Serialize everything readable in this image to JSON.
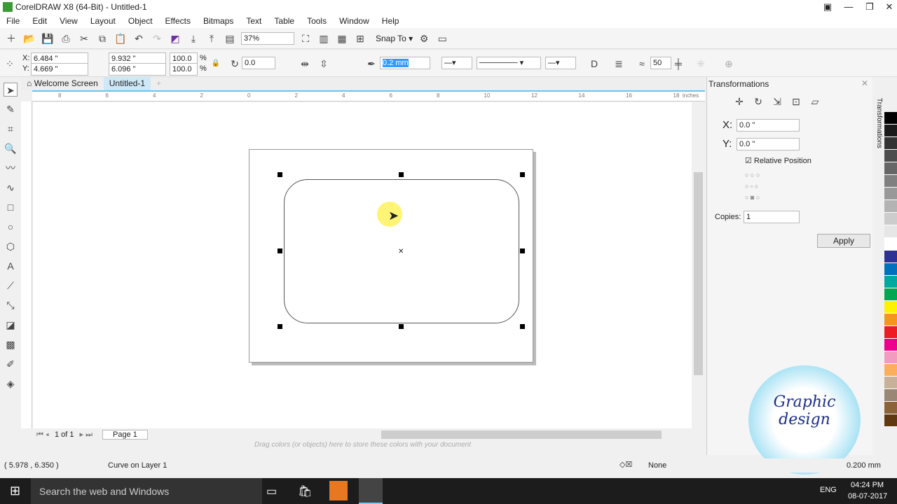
{
  "window": {
    "title": "CorelDRAW X8 (64-Bit) - Untitled-1"
  },
  "menu": [
    "File",
    "Edit",
    "View",
    "Layout",
    "Object",
    "Effects",
    "Bitmaps",
    "Text",
    "Table",
    "Tools",
    "Window",
    "Help"
  ],
  "toolbar": {
    "zoom": "37%",
    "snap_to": "Snap To"
  },
  "propbar": {
    "x": "6.484 \"",
    "y": "4.669 \"",
    "w": "9.932 \"",
    "h": "6.096 \"",
    "sx": "100.0",
    "sy": "100.0",
    "pct": "%",
    "rotation": "0.0",
    "outline": "0.2 mm",
    "smooth": "50"
  },
  "tabs": {
    "welcome": "Welcome Screen",
    "doc": "Untitled-1"
  },
  "ruler": {
    "labels": [
      "8",
      "6",
      "4",
      "2",
      "0",
      "2",
      "4",
      "6",
      "8",
      "10",
      "12",
      "14",
      "16",
      "18"
    ],
    "unit": "inches"
  },
  "docker": {
    "title": "Transformations",
    "side_label": "Transformations",
    "x_label": "X:",
    "x": "0.0 \"",
    "y_label": "Y:",
    "y": "0.0 \"",
    "relative": "Relative Position",
    "relative_checked": true,
    "copies_label": "Copies:",
    "copies": "1",
    "apply": "Apply"
  },
  "pagenav": {
    "pos": "1",
    "of": "of",
    "total": "1",
    "page_tab": "Page 1"
  },
  "palette_hint": "Drag colors (or objects) here to store these colors with your document",
  "palette_colors": [
    "#000000",
    "#1a1a1a",
    "#333333",
    "#4d4d4d",
    "#666666",
    "#808080",
    "#999999",
    "#b3b3b3",
    "#cccccc",
    "#e6e6e6",
    "#ffffff",
    "#2e3192",
    "#0072bc",
    "#00a99d",
    "#00a651",
    "#fff200",
    "#f7941d",
    "#ed1c24",
    "#ec008c",
    "#f49ac1",
    "#fbaf5d",
    "#c7b299",
    "#998675",
    "#8c6239",
    "#603913"
  ],
  "status": {
    "coords": "( 5.978 , 6.350 )",
    "object": "Curve on Layer 1",
    "fill": "None",
    "outline": "0.200 mm"
  },
  "taskbar": {
    "search": "Search the web and Windows",
    "lang": "ENG",
    "time": "04:24 PM",
    "date": "08-07-2017"
  },
  "logo": {
    "text": "Graphic design"
  }
}
